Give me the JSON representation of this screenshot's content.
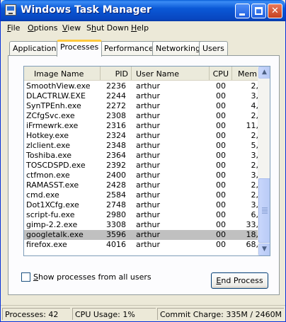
{
  "window": {
    "title": "Windows Task Manager"
  },
  "menu": [
    {
      "label": "File",
      "underline": "F",
      "rest": "ile"
    },
    {
      "label": "Options",
      "underline": "O",
      "rest": "ptions"
    },
    {
      "label": "View",
      "underline": "V",
      "rest": "iew"
    },
    {
      "label": "Shut Down",
      "pre": "S",
      "underline": "h",
      "rest": "ut Down"
    },
    {
      "label": "Help",
      "underline": "H",
      "rest": "elp"
    }
  ],
  "tabs": [
    "Applications",
    "Processes",
    "Performance",
    "Networking",
    "Users"
  ],
  "active_tab": "Processes",
  "columns": [
    "Image Name",
    "PID",
    "User Name",
    "CPU",
    "Mem U"
  ],
  "processes": [
    {
      "name": "SmoothView.exe",
      "pid": "2236",
      "user": "arthur",
      "cpu": "00",
      "mem": "2,"
    },
    {
      "name": "DLACTRLW.EXE",
      "pid": "2244",
      "user": "arthur",
      "cpu": "00",
      "mem": "3,"
    },
    {
      "name": "SynTPEnh.exe",
      "pid": "2272",
      "user": "arthur",
      "cpu": "00",
      "mem": "4,"
    },
    {
      "name": "ZCfgSvc.exe",
      "pid": "2308",
      "user": "arthur",
      "cpu": "00",
      "mem": "2,"
    },
    {
      "name": "iFrmewrk.exe",
      "pid": "2316",
      "user": "arthur",
      "cpu": "00",
      "mem": "11,"
    },
    {
      "name": "Hotkey.exe",
      "pid": "2324",
      "user": "arthur",
      "cpu": "00",
      "mem": "2,"
    },
    {
      "name": "zlclient.exe",
      "pid": "2348",
      "user": "arthur",
      "cpu": "00",
      "mem": "5,"
    },
    {
      "name": "Toshiba.exe",
      "pid": "2364",
      "user": "arthur",
      "cpu": "00",
      "mem": "3,"
    },
    {
      "name": "TOSCDSPD.exe",
      "pid": "2392",
      "user": "arthur",
      "cpu": "00",
      "mem": "2,"
    },
    {
      "name": "ctfmon.exe",
      "pid": "2400",
      "user": "arthur",
      "cpu": "00",
      "mem": "3,"
    },
    {
      "name": "RAMASST.exe",
      "pid": "2428",
      "user": "arthur",
      "cpu": "00",
      "mem": "2,"
    },
    {
      "name": "cmd.exe",
      "pid": "2584",
      "user": "arthur",
      "cpu": "00",
      "mem": "2,"
    },
    {
      "name": "Dot1XCfg.exe",
      "pid": "2748",
      "user": "arthur",
      "cpu": "00",
      "mem": "3,"
    },
    {
      "name": "script-fu.exe",
      "pid": "2980",
      "user": "arthur",
      "cpu": "00",
      "mem": "6,"
    },
    {
      "name": "gimp-2.2.exe",
      "pid": "3308",
      "user": "arthur",
      "cpu": "00",
      "mem": "33,"
    },
    {
      "name": "googletalk.exe",
      "pid": "3596",
      "user": "arthur",
      "cpu": "00",
      "mem": "18,",
      "selected": true
    },
    {
      "name": "firefox.exe",
      "pid": "4016",
      "user": "arthur",
      "cpu": "00",
      "mem": "68,"
    }
  ],
  "show_all_checkbox": {
    "pre": "",
    "underline": "S",
    "rest": "how processes from all users",
    "checked": false
  },
  "end_process_button": {
    "underline": "E",
    "rest": "nd Process"
  },
  "status": {
    "processes": "Processes: 42",
    "cpu": "CPU Usage: 1%",
    "commit": "Commit Charge: 335M / 2460M"
  },
  "colors": {
    "title_bar": "#0a58d6",
    "selection": "#c0c0c0",
    "tab_highlight": "#ffc83c"
  }
}
